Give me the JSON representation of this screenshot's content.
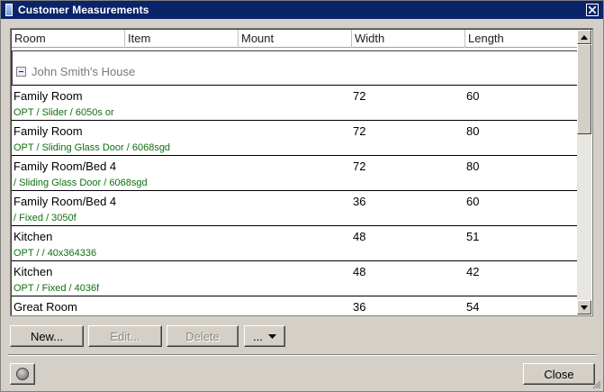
{
  "window": {
    "title": "Customer Measurements"
  },
  "grid": {
    "columns": [
      "Room",
      "Item",
      "Mount",
      "Width",
      "Length"
    ],
    "group": {
      "label": "John Smith's House"
    },
    "rows": [
      {
        "room": "Family Room",
        "width": "72",
        "length": "60",
        "desc": "OPT / Slider / 6050s or"
      },
      {
        "room": "Family Room",
        "width": "72",
        "length": "80",
        "desc": "OPT / Sliding Glass Door / 6068sgd"
      },
      {
        "room": "Family Room/Bed 4",
        "width": "72",
        "length": "80",
        "desc": "/ Sliding Glass Door / 6068sgd"
      },
      {
        "room": "Family Room/Bed 4",
        "width": "36",
        "length": "60",
        "desc": "/ Fixed / 3050f"
      },
      {
        "room": "Kitchen",
        "width": "48",
        "length": "51",
        "desc": "OPT /  / 40x364336"
      },
      {
        "room": "Kitchen",
        "width": "48",
        "length": "42",
        "desc": "OPT / Fixed / 4036f"
      },
      {
        "room": "Great Room",
        "width": "36",
        "length": "54",
        "desc": ""
      }
    ]
  },
  "buttons": {
    "new": "New...",
    "edit": "Edit...",
    "delete": "Delete",
    "more": "...",
    "close": "Close"
  },
  "icons": {
    "close": "close-icon",
    "help": "help-icon",
    "collapse": "collapse-icon",
    "dropdown": "chevron-down-icon"
  },
  "colors": {
    "title_bar": "#0a246a",
    "description_text": "#107010",
    "group_text": "#7a7a7a"
  }
}
